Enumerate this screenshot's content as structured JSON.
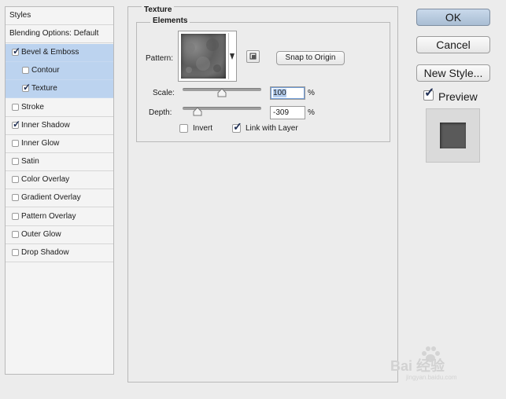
{
  "sidebar": {
    "header": "Styles",
    "blending": "Blending Options: Default",
    "items": [
      {
        "label": "Bevel & Emboss",
        "checked": true,
        "selected": true
      },
      {
        "label": "Contour",
        "checked": false,
        "selected": true
      },
      {
        "label": "Texture",
        "checked": true,
        "selected": true
      },
      {
        "label": "Stroke",
        "checked": false,
        "selected": false
      },
      {
        "label": "Inner Shadow",
        "checked": true,
        "selected": false
      },
      {
        "label": "Inner Glow",
        "checked": false,
        "selected": false
      },
      {
        "label": "Satin",
        "checked": false,
        "selected": false
      },
      {
        "label": "Color Overlay",
        "checked": false,
        "selected": false
      },
      {
        "label": "Gradient Overlay",
        "checked": false,
        "selected": false
      },
      {
        "label": "Pattern Overlay",
        "checked": false,
        "selected": false
      },
      {
        "label": "Outer Glow",
        "checked": false,
        "selected": false
      },
      {
        "label": "Drop Shadow",
        "checked": false,
        "selected": false
      }
    ]
  },
  "texture": {
    "section_title": "Texture",
    "group_title": "Elements",
    "pattern_label": "Pattern:",
    "snap_button": "Snap to Origin",
    "scale_label": "Scale:",
    "scale_value": "100",
    "scale_unit": "%",
    "depth_label": "Depth:",
    "depth_value": "-309",
    "depth_unit": "%",
    "invert_label": "Invert",
    "invert_checked": false,
    "link_label": "Link with Layer",
    "link_checked": true
  },
  "buttons": {
    "ok": "OK",
    "cancel": "Cancel",
    "new_style": "New Style...",
    "preview_label": "Preview",
    "preview_checked": true
  },
  "watermark": {
    "text": "Bai 经验",
    "sub": "jingyan.baidu.com"
  },
  "colors": {
    "selection": "#bcd3ef",
    "ok_button": "#b7c9de"
  }
}
